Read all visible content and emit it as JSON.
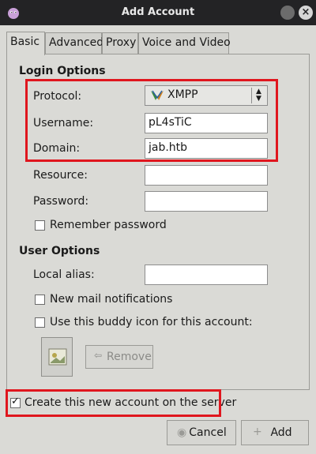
{
  "window": {
    "title": "Add Account"
  },
  "tabs": [
    "Basic",
    "Advanced",
    "Proxy",
    "Voice and Video"
  ],
  "login_options": {
    "title": "Login Options",
    "protocol_label": "Protocol:",
    "protocol_value": "XMPP",
    "username_label": "Username:",
    "username_value": "pL4sTiC",
    "domain_label": "Domain:",
    "domain_value": "jab.htb",
    "resource_label": "Resource:",
    "resource_value": "",
    "password_label": "Password:",
    "password_value": "",
    "remember_password_label": "Remember password",
    "remember_password_checked": false
  },
  "user_options": {
    "title": "User Options",
    "local_alias_label": "Local alias:",
    "local_alias_value": "",
    "new_mail_label": "New mail notifications",
    "new_mail_checked": false,
    "buddy_icon_label": "Use this buddy icon for this account:",
    "buddy_icon_checked": false,
    "remove_label": "Remove"
  },
  "create_on_server": {
    "label": "Create this new account on the server",
    "checked": true
  },
  "buttons": {
    "cancel": "Cancel",
    "add": "Add"
  },
  "colors": {
    "highlight": "#e0161e",
    "titlebar": "#232325",
    "background": "#dadad6"
  },
  "icons": [
    "pidgin-app-icon",
    "minimize-icon",
    "close-icon",
    "xmpp-icon",
    "spinner-icon",
    "buddy-icon-placeholder",
    "remove-icon",
    "cancel-icon",
    "add-icon"
  ]
}
